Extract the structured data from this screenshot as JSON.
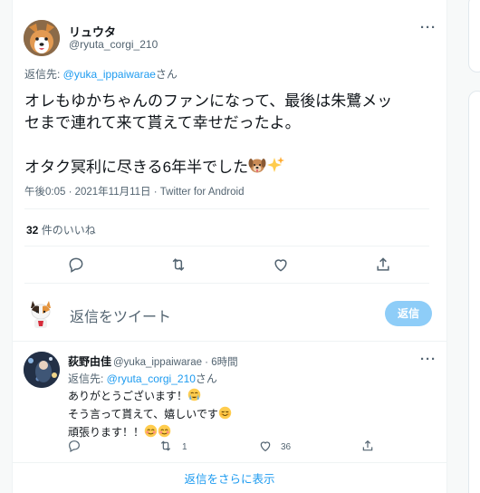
{
  "tweet": {
    "display_name": "リュウタ",
    "handle": "@ryuta_corgi_210",
    "replying_prefix": "返信先: ",
    "replying_to": "@yuka_ippaiwarae",
    "replying_suffix": "さん",
    "line1": "オレもゆかちゃんのファンになって、最後は朱鷺メッ",
    "line2": "セまで連れて来て貰えて幸せだったよ。",
    "line3": "オタク冥利に尽きる6年半でした",
    "timestamp": "午後0:05 · 2021年11月11日 · Twitter for Android",
    "likes_count": "32",
    "likes_label": " 件のいいね"
  },
  "compose": {
    "placeholder": "返信をツイート",
    "button": "返信"
  },
  "reply": {
    "display_name": "荻野由佳",
    "handle_time": "@yuka_ippaiwarae · 6時間",
    "replying_prefix": "返信先: ",
    "replying_to": "@ryuta_corgi_210",
    "replying_suffix": "さん",
    "line1": "ありがとうございます！",
    "line2": "そう言って貰えて、嬉しいです",
    "line3": "頑張ります！！",
    "retweets": "1",
    "likes": "36"
  },
  "show_more": "返信をさらに表示",
  "icons": [
    "reply-icon",
    "retweet-icon",
    "like-icon",
    "share-icon",
    "more-icon",
    "dog-emoji",
    "sparkles-emoji",
    "crying-emoji",
    "smile-emoji",
    "blush-emoji"
  ],
  "colors": {
    "link": "#1d9bf0",
    "muted": "#536471",
    "reply_button": "#8ecdf8"
  }
}
